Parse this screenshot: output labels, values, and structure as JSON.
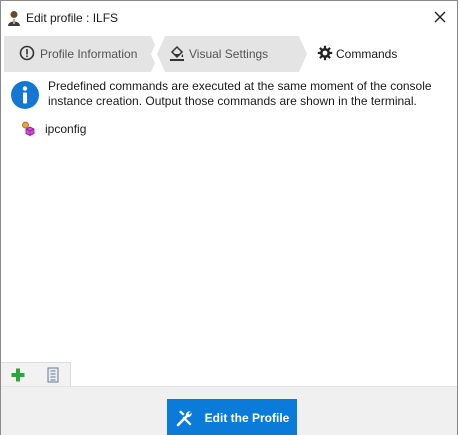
{
  "window": {
    "title": "Edit profile : ILFS",
    "close_symbol": "✕"
  },
  "tabs": [
    {
      "label": "Profile Information",
      "icon": "info-circle-icon",
      "active": false
    },
    {
      "label": "Visual Settings",
      "icon": "paint-bucket-icon",
      "active": false
    },
    {
      "label": "Commands",
      "icon": "gear-icon",
      "active": true
    }
  ],
  "commands_panel": {
    "info_text": "Predefined commands are executed at the same moment of the console instance creation. Output those commands are shown in the terminal.",
    "items": [
      {
        "label": "ipconfig",
        "icon": "command-icon"
      }
    ]
  },
  "toolbar": {
    "add_icon": "plus-icon",
    "remove_icon": "delete-icon"
  },
  "footer": {
    "edit_button_label": "Edit the Profile",
    "edit_button_icon": "tools-icon"
  },
  "colors": {
    "accent": "#0a7bd8",
    "info_blue": "#1477d4",
    "add_green": "#2aa63a"
  }
}
